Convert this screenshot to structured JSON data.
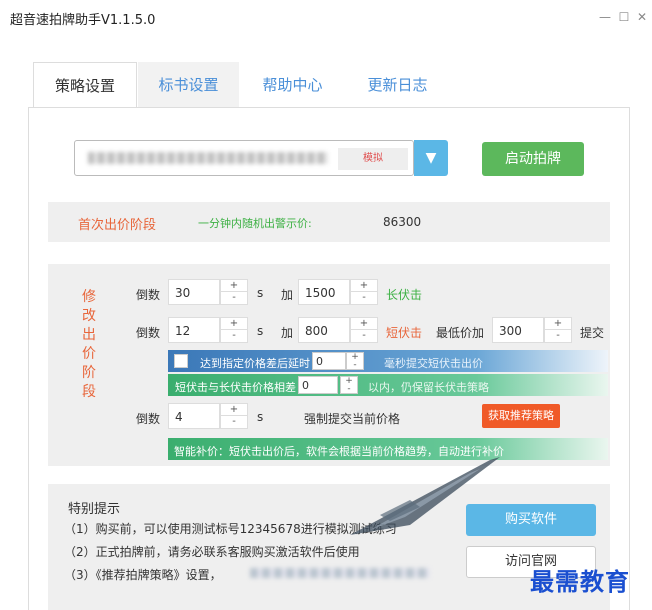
{
  "window": {
    "title": "超音速拍牌助手V1.1.5.0",
    "minimize_glyph": "—",
    "maximize_glyph": "☐",
    "close_glyph": "✕"
  },
  "tabs": [
    {
      "label": "策略设置"
    },
    {
      "label": "标书设置"
    },
    {
      "label": "帮助中心"
    },
    {
      "label": "更新日志"
    }
  ],
  "server": {
    "mode_label": "模拟",
    "dropdown_glyph": "▼"
  },
  "start_button": "启动拍牌",
  "first_stage": {
    "title": "首次出价阶段",
    "label": "一分钟内随机出警示价:",
    "value": "86300"
  },
  "modify_stage": {
    "title_chars": [
      "修",
      "改",
      "出",
      "价",
      "阶",
      "段"
    ],
    "row1": {
      "countdown_label": "倒数",
      "countdown": "30",
      "unit": "s",
      "add_label": "加",
      "add_value": "1500",
      "strike_label": "长伏击"
    },
    "row2": {
      "countdown_label": "倒数",
      "countdown": "12",
      "unit": "s",
      "add_label": "加",
      "add_value": "800",
      "strike_label": "短伏击",
      "min_label": "最低价加",
      "min_value": "300",
      "submit_label": "提交"
    },
    "delay_bar": {
      "text1": "达到指定价格差后延时",
      "value": "0",
      "text2": "毫秒提交短伏击出价"
    },
    "diff_bar": {
      "text1": "短伏击与长伏击价格相差",
      "value": "0",
      "text2": "以内，仍保留长伏击策略"
    },
    "row3": {
      "countdown_label": "倒数",
      "countdown": "4",
      "unit": "s",
      "force_label": "强制提交当前价格",
      "recommend_button": "获取推荐策略"
    },
    "smart_bar": {
      "text": "智能补价：短伏击出价后，软件会根据当前价格趋势，自动进行补价"
    }
  },
  "notes": {
    "title": "特别提示",
    "lines": [
      "（1）购买前，可以使用测试标号12345678进行模拟测试练习",
      "（2）正式拍牌前，请务必联系客服购买激活软件后使用",
      "（3）《推荐拍牌策略》设置，"
    ],
    "buy_button": "购买软件",
    "site_button": "访问官网"
  },
  "watermark": "最需教育",
  "spin": {
    "up": "+",
    "down": "-"
  },
  "colors": {
    "accent_blue": "#5bb7e6",
    "start_green": "#5cb85c",
    "orange": "#e8663b",
    "recommend_red": "#f05a28",
    "watermark_blue": "#1a4fd0"
  }
}
